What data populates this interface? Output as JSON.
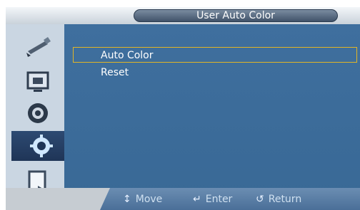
{
  "title": "User Auto Color",
  "menu": {
    "items": [
      {
        "label": "Auto Color"
      },
      {
        "label": "Reset"
      }
    ]
  },
  "sidebar": {
    "icons": [
      {
        "name": "picture-icon"
      },
      {
        "name": "screen-icon"
      },
      {
        "name": "sound-icon"
      },
      {
        "name": "setup-icon",
        "selected": true
      },
      {
        "name": "multi-control-icon"
      }
    ]
  },
  "hints": {
    "move": "Move",
    "enter": "Enter",
    "return": "Return"
  },
  "colors": {
    "panel": "#3f6f9e",
    "selection_border": "#e2b526",
    "sidebar": "#cad6e2",
    "selected_icon_bg": "#2d4a72"
  }
}
